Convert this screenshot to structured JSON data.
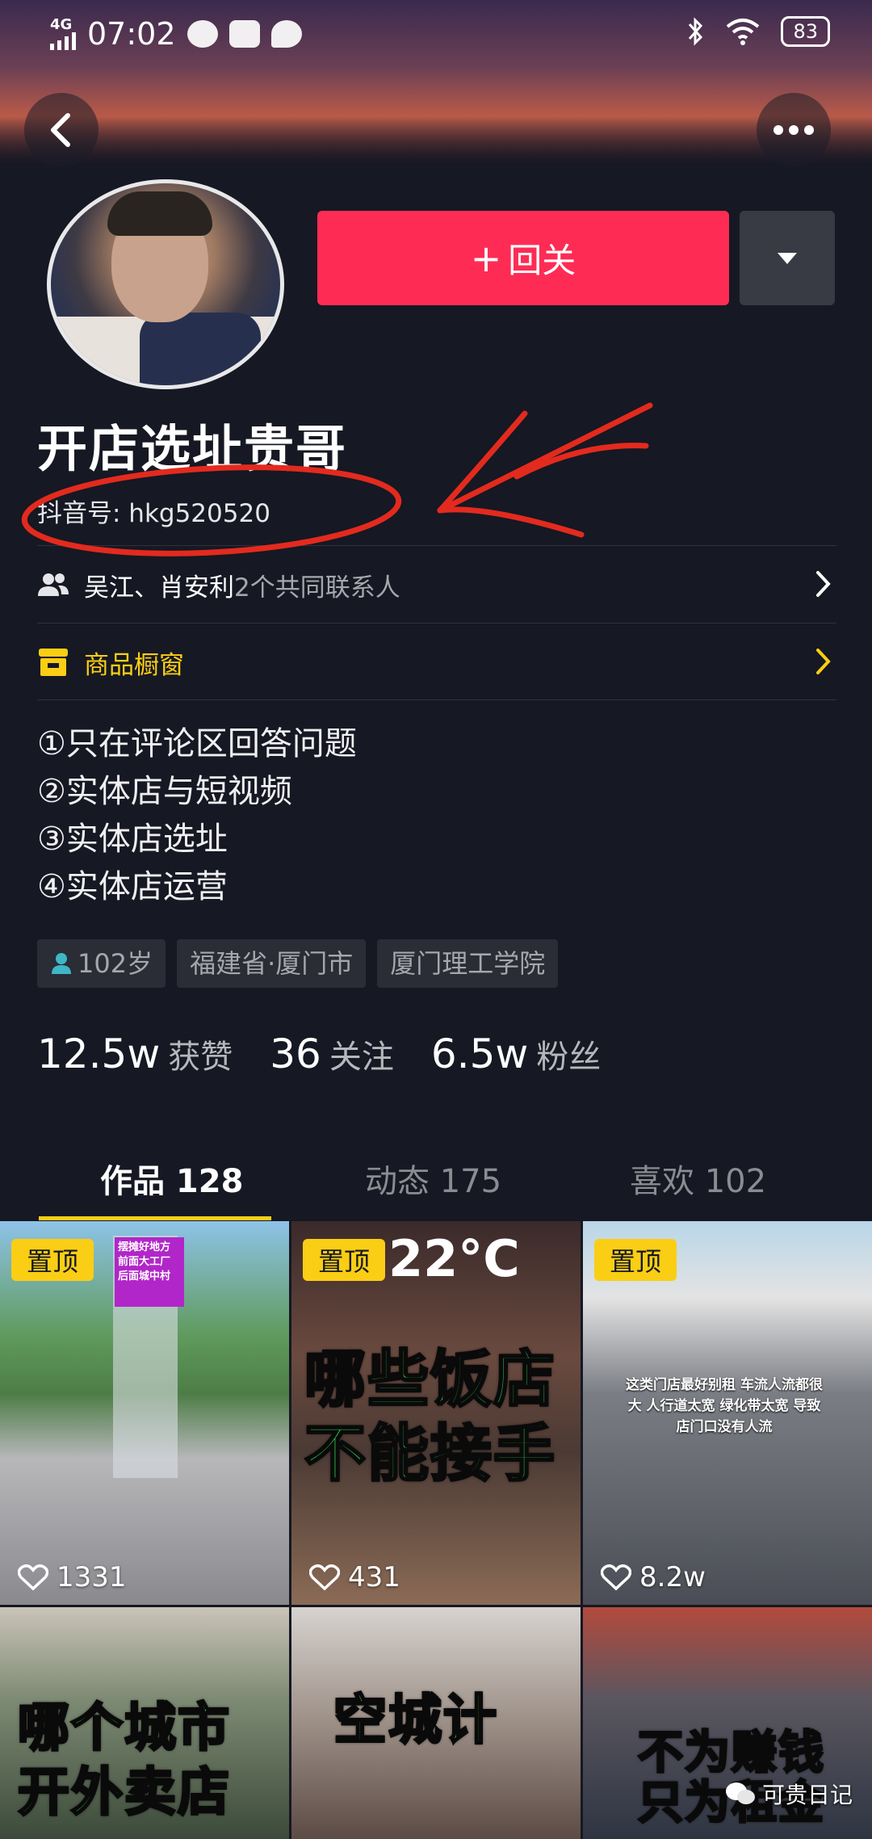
{
  "status_bar": {
    "network": "4G",
    "time": "07:02",
    "battery": "83"
  },
  "profile": {
    "nickname": "开店选址贵哥",
    "douyin_id": "抖音号: hkg520520",
    "follow_button": "回关",
    "mutual_names": "吴江、肖安利",
    "mutual_suffix": "2个共同联系人",
    "shop_window": "商品橱窗"
  },
  "bio_lines": [
    "①只在评论区回答问题",
    "②实体店与短视频",
    "③实体店选址",
    "④实体店运营"
  ],
  "tags": {
    "age": "102岁",
    "location": "福建省·厦门市",
    "school": "厦门理工学院"
  },
  "stats": [
    {
      "value": "12.5w",
      "label": "获赞"
    },
    {
      "value": "36",
      "label": "关注"
    },
    {
      "value": "6.5w",
      "label": "粉丝"
    }
  ],
  "tabs": [
    {
      "label": "作品 128",
      "active": true
    },
    {
      "label": "动态 175",
      "active": false
    },
    {
      "label": "喜欢 102",
      "active": false
    }
  ],
  "videos": [
    {
      "pinned": "置顶",
      "likes": "1331",
      "caption": "摆摊好地方 前面大工厂 后面城中村"
    },
    {
      "pinned": "置顶",
      "likes": "431",
      "caption_line1": "哪些饭店",
      "caption_line2": "不能接手",
      "temp": "22°C"
    },
    {
      "pinned": "置顶",
      "likes": "8.2w",
      "caption": "这类门店最好别租 车流人流都很大 人行道太宽 绿化带太宽 导致店门口没有人流"
    },
    {
      "caption_line1": "哪个城市",
      "caption_line2": "开外卖店"
    },
    {
      "caption": "空城计"
    },
    {
      "caption_line1": "不为赚钱",
      "caption_line2": "只为租金"
    }
  ],
  "watermark": "可贵日记"
}
